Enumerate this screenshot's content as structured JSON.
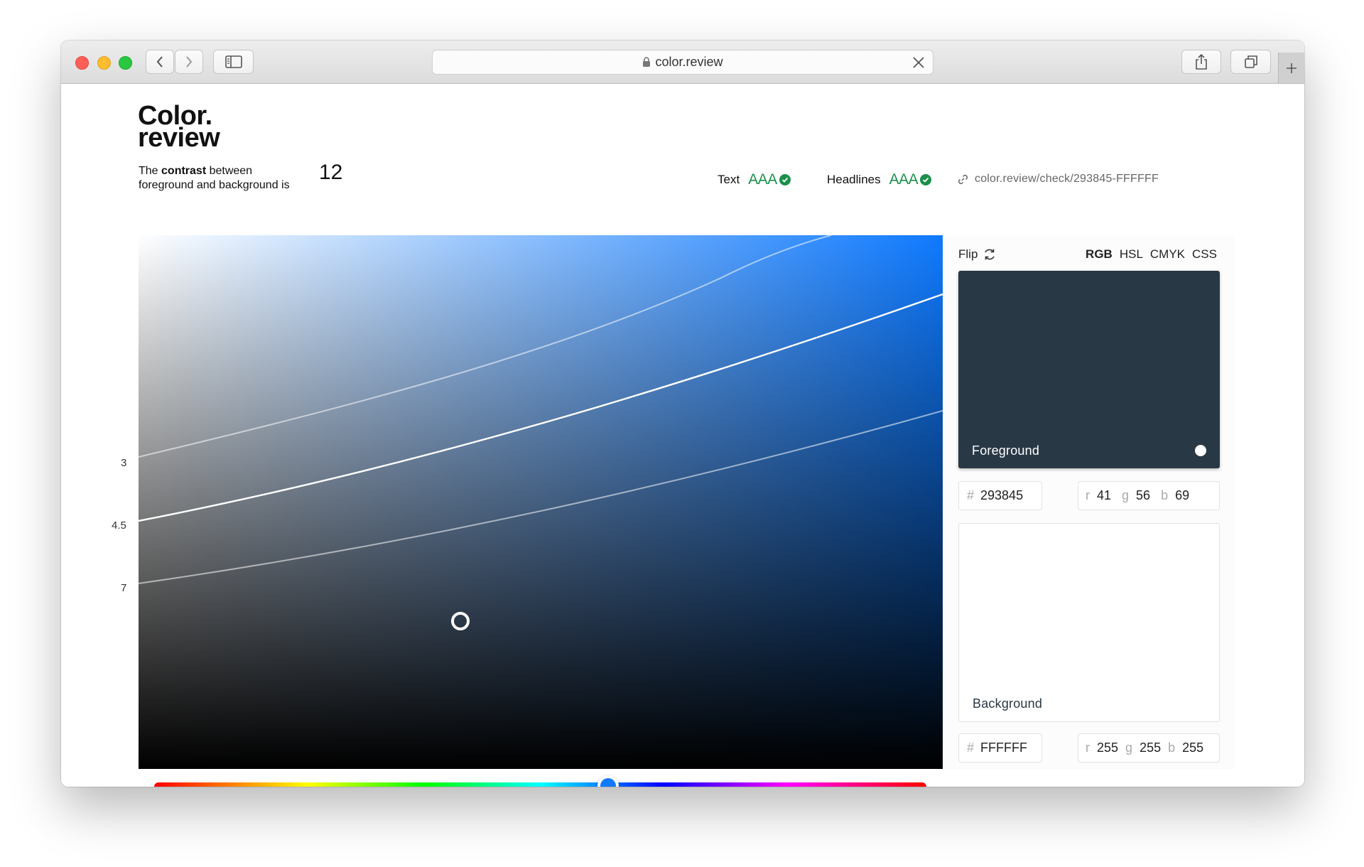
{
  "browser": {
    "url": "color.review"
  },
  "header": {
    "logo_line1": "Color.",
    "logo_line2": "review",
    "contrast_prefix": "The ",
    "contrast_bold": "contrast",
    "contrast_suffix": " between",
    "contrast_line2": "foreground and background is",
    "contrast_value": "12",
    "text_label": "Text",
    "text_rating": "AAA",
    "headlines_label": "Headlines",
    "headlines_rating": "AAA",
    "share_link": "color.review/check/293845-FFFFFF"
  },
  "picker": {
    "ticks": [
      "3",
      "4.5",
      "7"
    ],
    "hue_color": "#0f7aff"
  },
  "panel": {
    "flip_label": "Flip",
    "modes": [
      "RGB",
      "HSL",
      "CMYK",
      "CSS"
    ],
    "active_mode": "RGB",
    "foreground": {
      "label": "Foreground",
      "color": "#293845",
      "hash": "#",
      "hex": "293845",
      "r_label": "r",
      "r": "41",
      "g_label": "g",
      "g": "56",
      "b_label": "b",
      "b": "69"
    },
    "background": {
      "label": "Background",
      "color": "#FFFFFF",
      "hash": "#",
      "hex": "FFFFFF",
      "r_label": "r",
      "r": "255",
      "g_label": "g",
      "g": "255",
      "b_label": "b",
      "b": "255"
    }
  },
  "colors": {
    "accent_green": "#1b8f4b",
    "hue_blue": "#0f7aff"
  }
}
